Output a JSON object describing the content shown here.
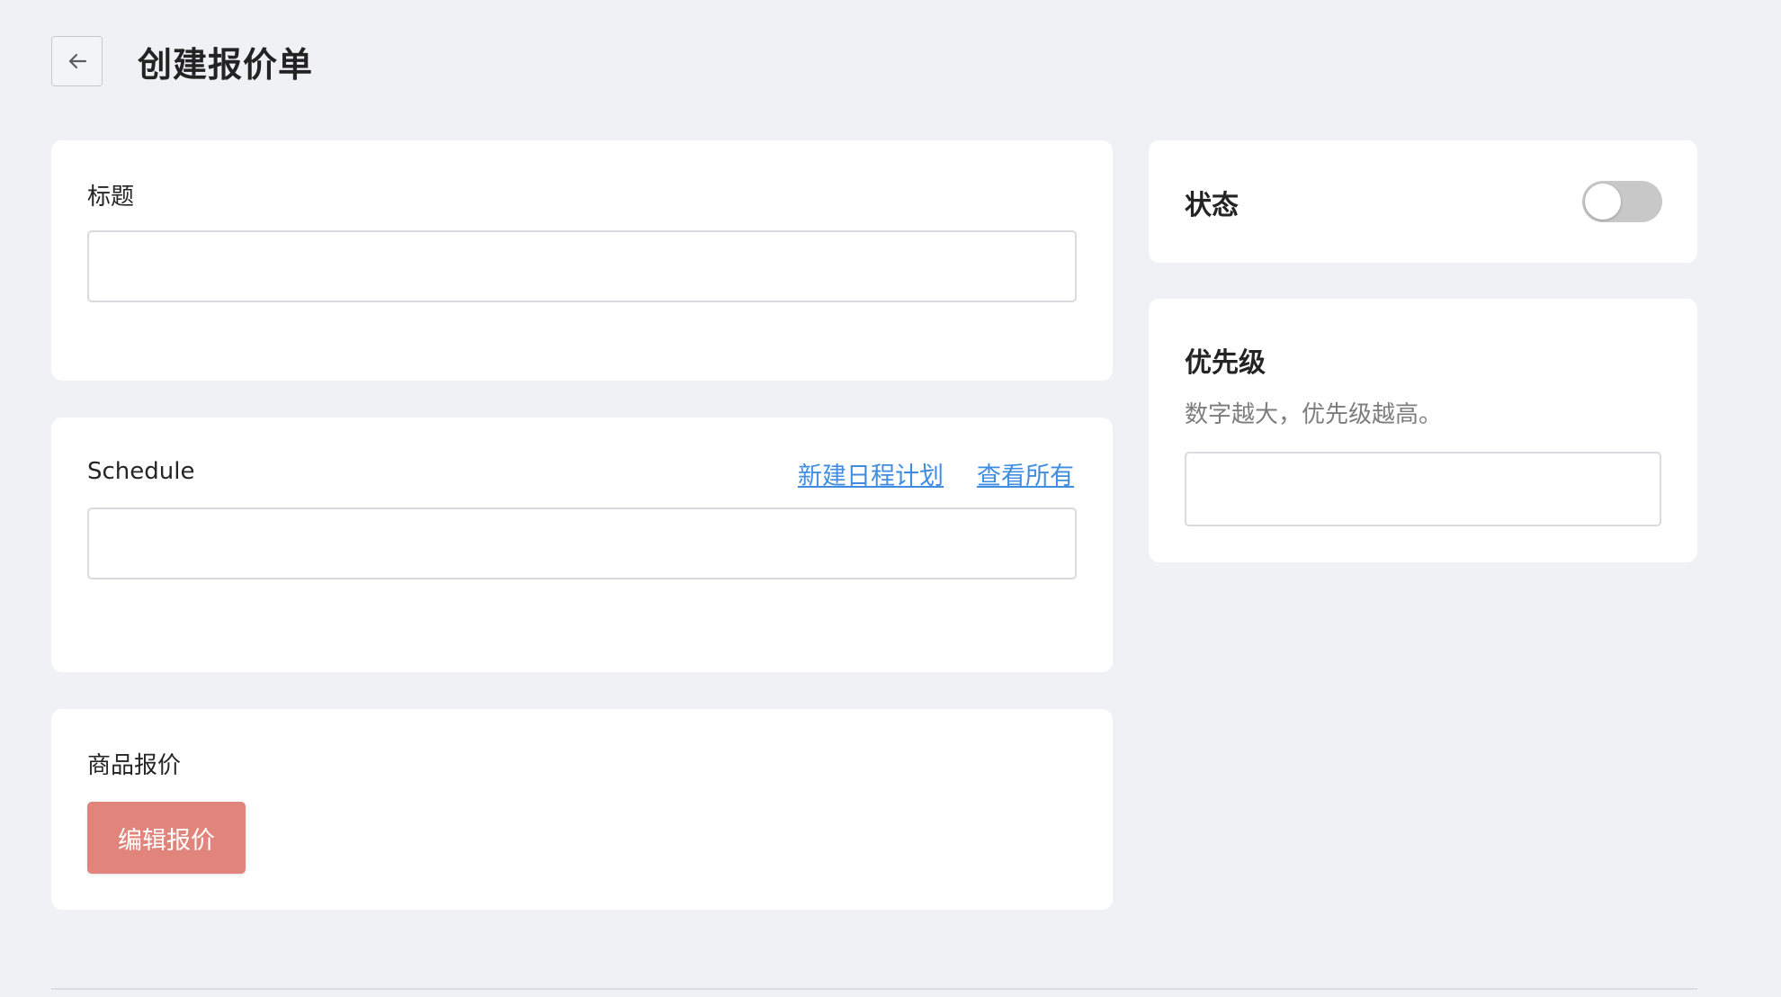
{
  "header": {
    "title": "创建报价单",
    "back_icon": "arrow-left-icon"
  },
  "title_card": {
    "label": "标题",
    "input_value": "",
    "input_placeholder": ""
  },
  "schedule_card": {
    "label": "Schedule",
    "link_new": "新建日程计划",
    "link_view_all": "查看所有",
    "input_value": "",
    "input_placeholder": ""
  },
  "quote_card": {
    "label": "商品报价",
    "edit_button": "编辑报价"
  },
  "status_card": {
    "label": "状态",
    "toggle_on": false
  },
  "priority_card": {
    "label": "优先级",
    "hint": "数字越大，优先级越高。",
    "input_value": "",
    "input_placeholder": ""
  },
  "colors": {
    "background": "#f0f1f4",
    "link": "#3f8ce0",
    "primary_button": "#e1857c",
    "toggle_off": "#c8c8c8"
  }
}
